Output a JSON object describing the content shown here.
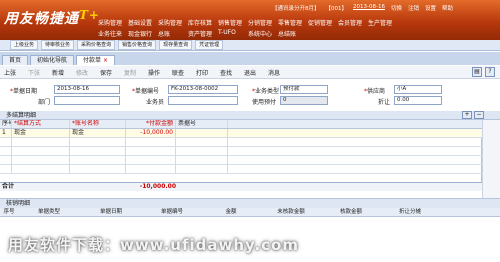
{
  "app": {
    "logo": "用友畅捷通",
    "logo_mark": "T+"
  },
  "status": {
    "account": "【通讯录分开8月】",
    "code": "【001】",
    "date": "2013-08-16",
    "items": [
      "切换",
      "注销",
      "设置",
      "帮助"
    ]
  },
  "menu_row1": [
    "采购管理",
    "基础设置",
    "采购管理",
    "库存核算",
    "销售管理",
    "分销管理",
    "零售管理",
    "促销管理",
    "会员管理",
    "生产管理"
  ],
  "menu_row2": [
    "业务往来",
    "现金银行",
    "总账",
    "资产管理",
    "T-UFO",
    "系统中心",
    "总结账"
  ],
  "quickbar": [
    "上级业务",
    "待审核业务",
    "采购价格查询",
    "销售价格查询",
    "现存量查询",
    "凭证管理"
  ],
  "tabs": [
    "首页",
    "初始化导航",
    "付款单"
  ],
  "toolbar": {
    "items": [
      "上张",
      "下张",
      "新增",
      "修改",
      "保存",
      "复制",
      "操作",
      "联查",
      "打印",
      "查找",
      "退出",
      "消息"
    ]
  },
  "form": {
    "date_label": "单据日期",
    "date_value": "2013-08-16",
    "code_label": "单据编号",
    "code_value": "FK-2013-08-0002",
    "type_label": "业务类型",
    "type_value": "预付款",
    "supplier_label": "供应商",
    "supplier_value": "小A",
    "dept_label": "部门",
    "dept_value": "",
    "staff_label": "业务员",
    "staff_value": "",
    "prepay_label": "使用预付",
    "prepay_value": "0",
    "discount_label": "折让",
    "discount_value": "0.00"
  },
  "detail": {
    "title": "多结算明细",
    "columns": [
      "序号",
      "*结算方式",
      "*账号名称",
      "*付款金额",
      "票据号"
    ],
    "rows": [
      [
        "1",
        "现金",
        "现金",
        "-10,000.00",
        ""
      ]
    ],
    "total_label": "合计",
    "total_value": "-10,000.00"
  },
  "verify": {
    "title": "核销明细",
    "columns": [
      "序号",
      "单据类型",
      "单据日期",
      "单据编号",
      "金额",
      "未核款金额",
      "核款金额",
      "折让分摊"
    ]
  },
  "watermark": "用友软件下载：www.ufidawhy.com"
}
